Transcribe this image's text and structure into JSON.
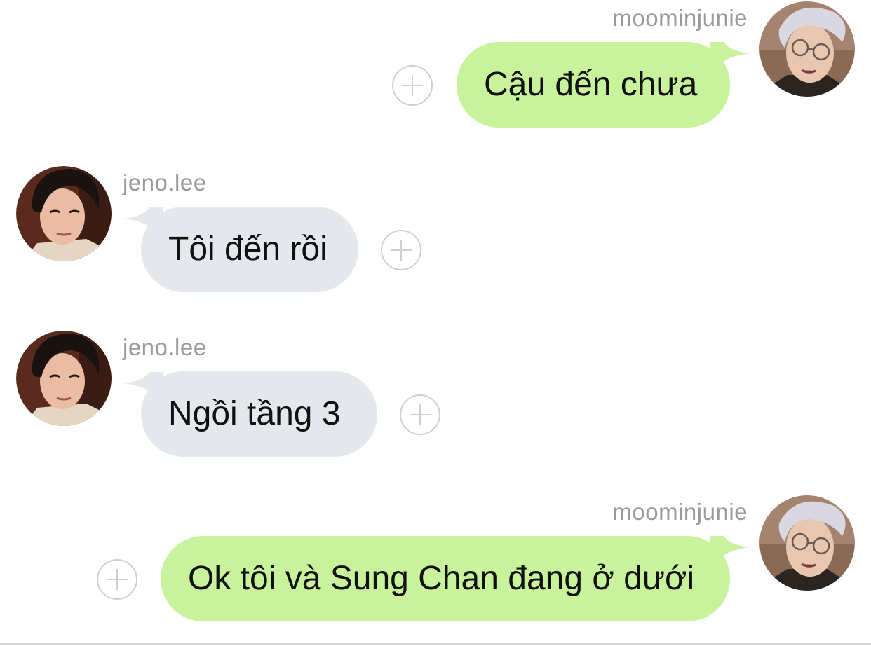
{
  "colors": {
    "outgoing_bubble": "#c9f29d",
    "incoming_bubble": "#e4e7eb",
    "username_text": "#9a9a9a",
    "add_icon": "#cfcfcf",
    "message_text": "#111111"
  },
  "messages": [
    {
      "sender": "moominjunie",
      "direction": "outgoing",
      "text": "Cậu đến chưa",
      "avatar_icon": "user-avatar-glasses"
    },
    {
      "sender": "jeno.lee",
      "direction": "incoming",
      "text": "Tôi đến rồi",
      "avatar_icon": "user-avatar"
    },
    {
      "sender": "jeno.lee",
      "direction": "incoming",
      "text": "Ngồi tầng 3",
      "avatar_icon": "user-avatar"
    },
    {
      "sender": "moominjunie",
      "direction": "outgoing",
      "text": "Ok tôi và Sung Chan đang ở dưới",
      "avatar_icon": "user-avatar-glasses"
    }
  ],
  "reaction_icon": "plus-circle-icon"
}
